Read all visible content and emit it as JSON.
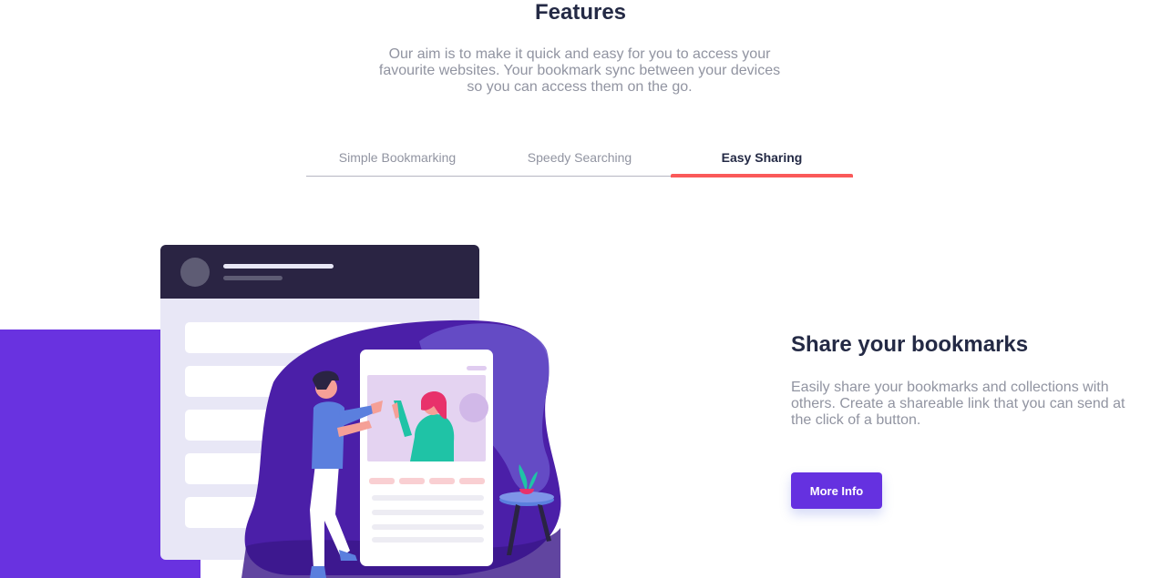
{
  "features": {
    "title": "Features",
    "intro": "Our aim is to make it quick and easy for you to access your favourite websites. Your bookmark sync between your devices so you can access them on the go."
  },
  "tabs": [
    {
      "label": "Simple Bookmarking",
      "active": false
    },
    {
      "label": "Speedy Searching",
      "active": false
    },
    {
      "label": "Easy Sharing",
      "active": true
    }
  ],
  "panel": {
    "title": "Share your bookmarks",
    "text": "Easily share your bookmarks and collections with others. Create a shareable link that you can send at the click of a button.",
    "button_label": "More Info"
  },
  "colors": {
    "heading": "#242A45",
    "body_text": "#9194A1",
    "accent_red": "#FA5959",
    "accent_purple": "#6932E0",
    "dark_navy": "#2A2443"
  },
  "illustration": {
    "icon": "sharing-illustration"
  }
}
